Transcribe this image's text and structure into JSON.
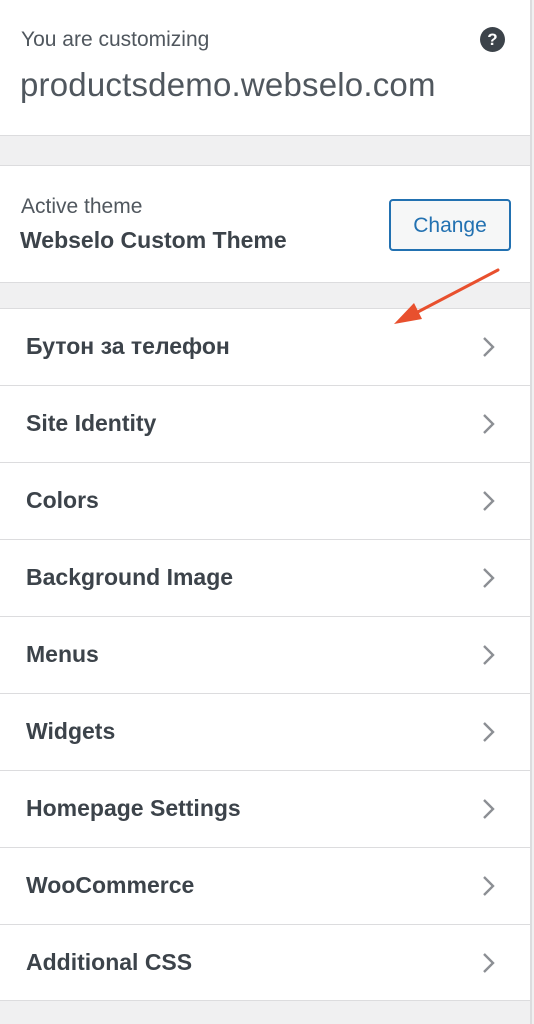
{
  "header": {
    "pre_title": "You are customizing",
    "site_title": "productsdemo.webselo.com",
    "help_glyph": "?"
  },
  "theme": {
    "label": "Active theme",
    "name": "Webselo Custom Theme",
    "change_label": "Change"
  },
  "menu": {
    "items": [
      {
        "label": "Бутон за телефон"
      },
      {
        "label": "Site Identity"
      },
      {
        "label": "Colors"
      },
      {
        "label": "Background Image"
      },
      {
        "label": "Menus"
      },
      {
        "label": "Widgets"
      },
      {
        "label": "Homepage Settings"
      },
      {
        "label": "WooCommerce"
      },
      {
        "label": "Additional CSS"
      }
    ]
  },
  "colors": {
    "accent": "#2271b1",
    "annotation_arrow": "#e8502e",
    "text": "#3c434a"
  },
  "icons": {
    "help": "help-icon",
    "chevron": "chevron-right-icon",
    "annotation": "annotation-arrow"
  }
}
